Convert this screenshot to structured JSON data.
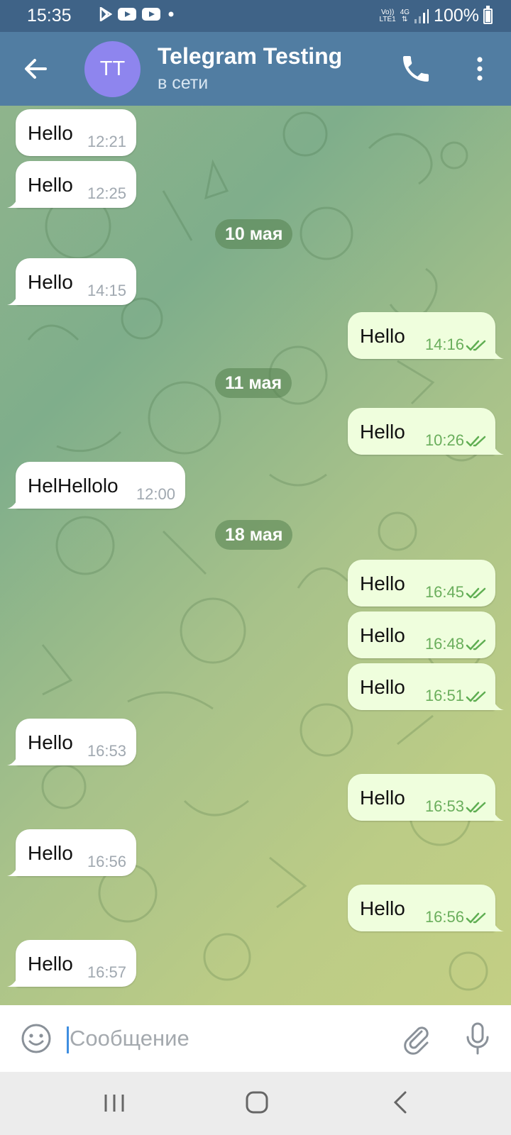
{
  "status_bar": {
    "time": "15:35",
    "volte": "Vo))",
    "lte": "LTE1",
    "network": "4G",
    "battery": "100%"
  },
  "header": {
    "avatar_initials": "TT",
    "title": "Telegram Testing",
    "status": "в сети"
  },
  "messages": [
    {
      "dir": "in",
      "text": "Hello",
      "time": "12:21"
    },
    {
      "dir": "in",
      "text": "Hello",
      "time": "12:25"
    },
    {
      "date": "10 мая"
    },
    {
      "dir": "in",
      "text": "Hello",
      "time": "14:15"
    },
    {
      "dir": "out",
      "text": "Hello",
      "time": "14:16"
    },
    {
      "date": "11 мая"
    },
    {
      "dir": "out",
      "text": "Hello",
      "time": "10:26"
    },
    {
      "dir": "in",
      "text": "HelHellolo",
      "time": "12:00"
    },
    {
      "date": "18 мая"
    },
    {
      "dir": "out",
      "text": "Hello",
      "time": "16:45"
    },
    {
      "dir": "out",
      "text": "Hello",
      "time": "16:48"
    },
    {
      "dir": "out",
      "text": "Hello",
      "time": "16:51"
    },
    {
      "dir": "in",
      "text": "Hello",
      "time": "16:53"
    },
    {
      "dir": "out",
      "text": "Hello",
      "time": "16:53"
    },
    {
      "dir": "in",
      "text": "Hello",
      "time": "16:56"
    },
    {
      "dir": "out",
      "text": "Hello",
      "time": "16:56"
    },
    {
      "dir": "in",
      "text": "Hello",
      "time": "16:57"
    }
  ],
  "input": {
    "placeholder": "Сообщение",
    "value": ""
  },
  "icons": {
    "back": "arrow-left-icon",
    "call": "phone-icon",
    "menu": "more-vertical-icon",
    "emoji": "smile-icon",
    "attach": "paperclip-icon",
    "mic": "microphone-icon",
    "read": "double-check-icon"
  },
  "colors": {
    "header": "#517da2",
    "status_bar": "#3f6387",
    "avatar": "#8e85ee",
    "incoming_bubble": "#ffffff",
    "outgoing_bubble": "#effedd",
    "outgoing_time": "#6aae5c"
  }
}
